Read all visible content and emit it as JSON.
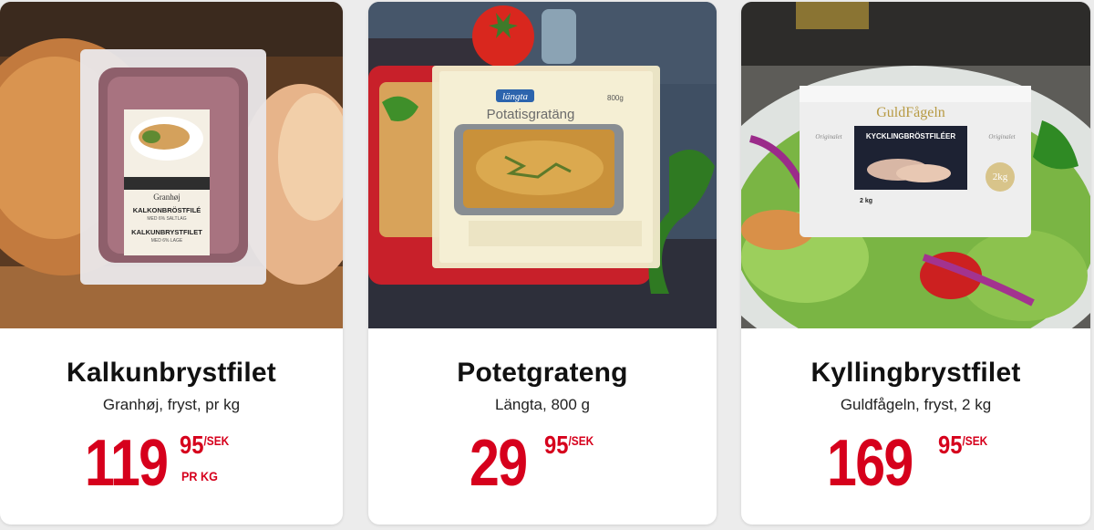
{
  "products": [
    {
      "name": "Kalkunbrystfilet",
      "subtitle": "Granhøj, fryst, pr kg",
      "price_whole": "119",
      "price_decimal": "95",
      "currency": "/SEK",
      "unit": "PR KG",
      "package_texts": [
        "Granhøj",
        "KALKONBRÖSTFILÉ",
        "MED 6% SALTLAG",
        "KALKUNBRYSTFILET",
        "MED 6% LAGE"
      ]
    },
    {
      "name": "Potetgrateng",
      "subtitle": "Längta, 800 g",
      "price_whole": "29",
      "price_decimal": "95",
      "currency": "/SEK",
      "unit": "",
      "package_texts": [
        "längta",
        "Potatisgratäng",
        "800g"
      ]
    },
    {
      "name": "Kyllingbrystfilet",
      "subtitle": "Guldfågeln, fryst, 2 kg",
      "price_whole": "169",
      "price_decimal": "95",
      "currency": "/SEK",
      "unit": "",
      "package_texts": [
        "GuldFågeln",
        "KYCKLINGBRÖSTFILÉER",
        "Originalet",
        "Originalet",
        "2kg",
        "2 kg"
      ]
    }
  ],
  "colors": {
    "price_red": "#d6001c",
    "card_bg": "#ffffff",
    "page_bg": "#ececec"
  }
}
